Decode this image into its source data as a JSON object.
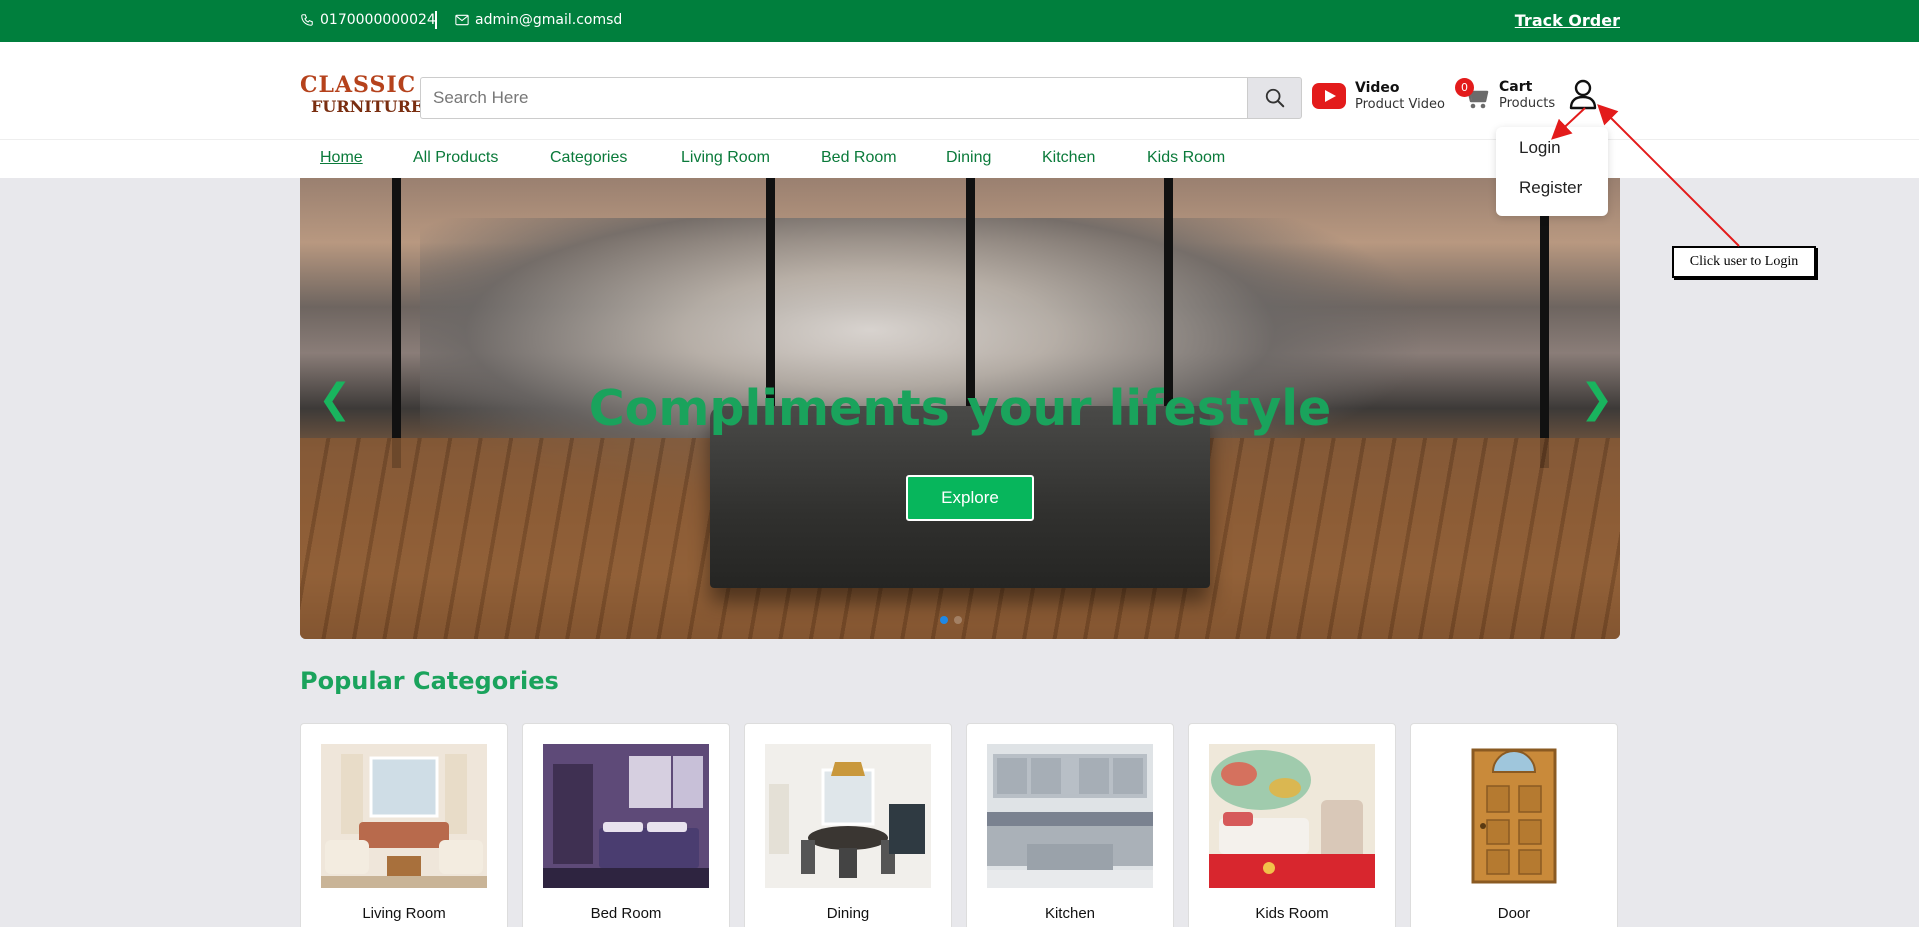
{
  "topbar": {
    "phone": "0170000000024",
    "email": "admin@gmail.comsd",
    "track_order": "Track Order"
  },
  "header": {
    "logo_line1": "CLASSIC",
    "logo_line2": "FURNITURE",
    "search_placeholder": "Search Here",
    "video_title": "Video",
    "video_sub": "Product Video",
    "cart_count": "0",
    "cart_title": "Cart",
    "cart_sub": "Products"
  },
  "nav": {
    "items": [
      "Home",
      "All Products",
      "Categories",
      "Living Room",
      "Bed Room",
      "Dining",
      "Kitchen",
      "Kids Room"
    ]
  },
  "user_menu": {
    "items": [
      "Login",
      "Register"
    ]
  },
  "hero": {
    "title": "Compliments your lifestyle",
    "button": "Explore"
  },
  "categories": {
    "title": "Popular Categories",
    "items": [
      "Living Room",
      "Bed Room",
      "Dining",
      "Kitchen",
      "Kids Room",
      "Door"
    ]
  },
  "annotation": {
    "text": "Click user to Login",
    "color": "#e31b1b"
  },
  "colors": {
    "brand_green": "#007f3d",
    "accent_green": "#1aa35c",
    "badge_red": "#e31b1b"
  }
}
